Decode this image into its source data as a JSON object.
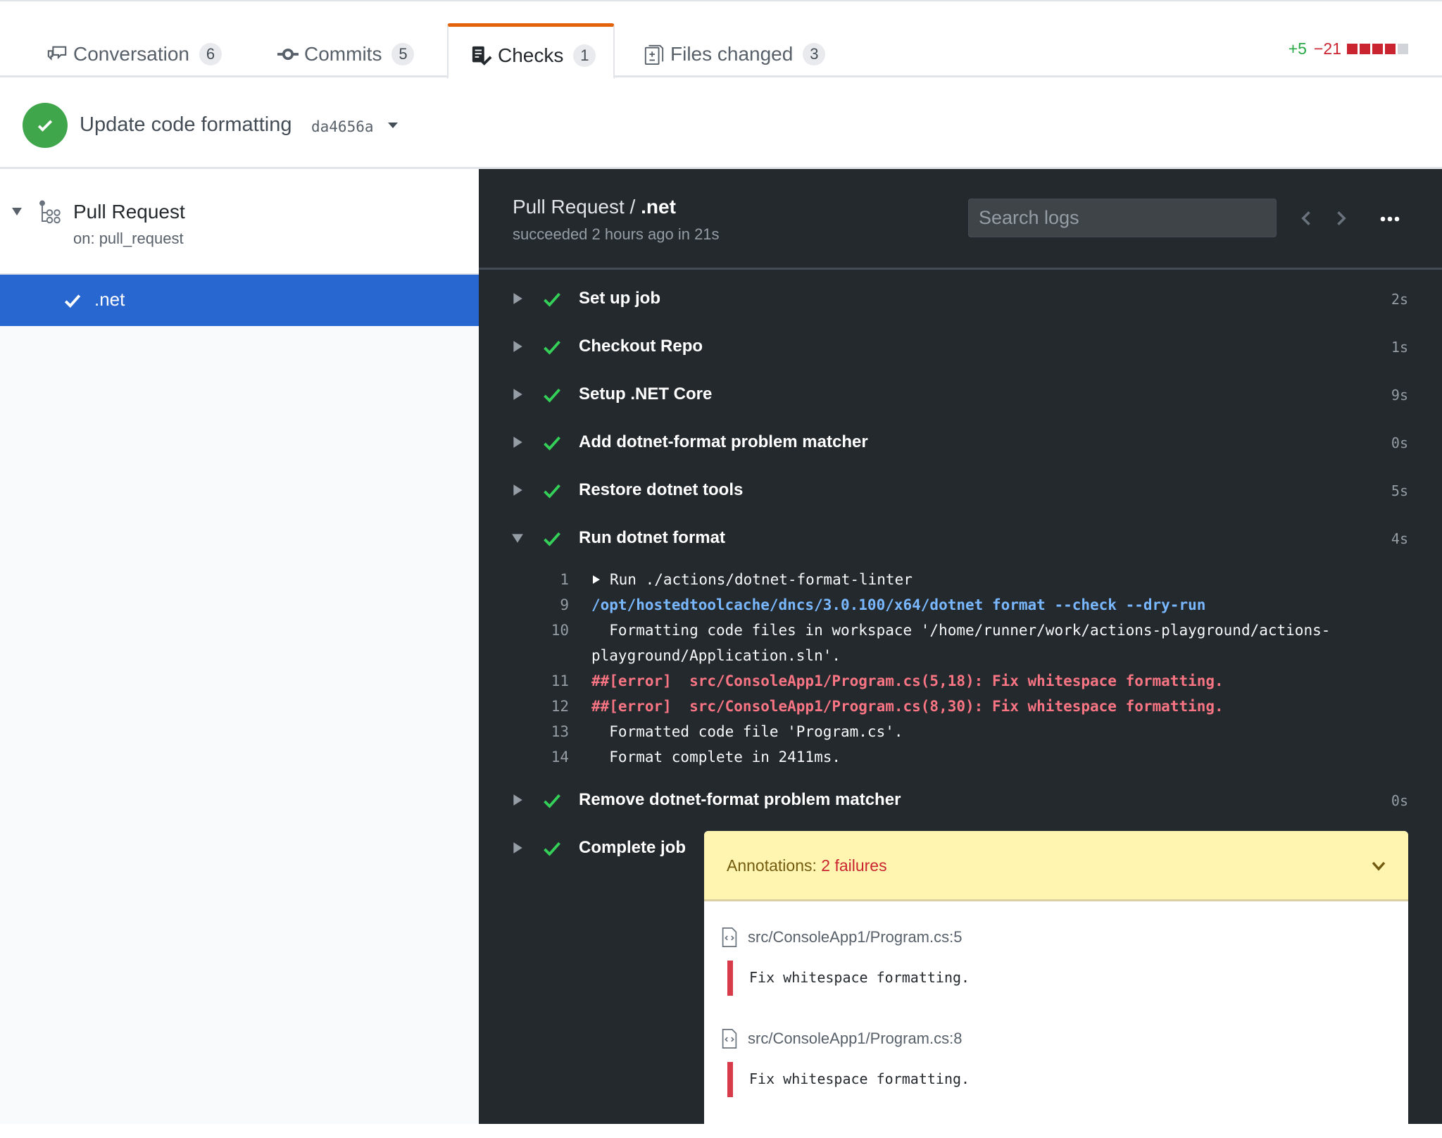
{
  "tabs": [
    {
      "id": "conversation",
      "label": "Conversation",
      "count": "6",
      "icon": "comment-discussion-icon",
      "selected": false
    },
    {
      "id": "commits",
      "label": "Commits",
      "count": "5",
      "icon": "git-commit-icon",
      "selected": false
    },
    {
      "id": "checks",
      "label": "Checks",
      "count": "1",
      "icon": "checklist-icon",
      "selected": true
    },
    {
      "id": "files",
      "label": "Files changed",
      "count": "3",
      "icon": "diff-icon",
      "selected": false
    }
  ],
  "diffstat": {
    "additions": "+5",
    "deletions": "−21",
    "blocks": [
      "deleted",
      "deleted",
      "deleted",
      "deleted",
      "neutral"
    ],
    "colors": {
      "add": "#28a745",
      "del": "#cb2431",
      "neutral": "#d1d5da"
    }
  },
  "commit": {
    "status": "success",
    "title": "Update code formatting",
    "sha": "da4656a"
  },
  "workflow": {
    "name": "Pull Request",
    "trigger": "on: pull_request",
    "jobs": [
      {
        "name": ".net",
        "status": "success",
        "selected": true
      }
    ]
  },
  "log": {
    "title_prefix": "Pull Request / ",
    "title_job": ".net",
    "subtitle": "succeeded 2 hours ago in 21s",
    "search_placeholder": "Search logs",
    "steps": [
      {
        "name": "Set up job",
        "duration": "2s",
        "expanded": false
      },
      {
        "name": "Checkout Repo",
        "duration": "1s",
        "expanded": false
      },
      {
        "name": "Setup .NET Core",
        "duration": "9s",
        "expanded": false
      },
      {
        "name": "Add dotnet-format problem matcher",
        "duration": "0s",
        "expanded": false
      },
      {
        "name": "Restore dotnet tools",
        "duration": "5s",
        "expanded": false
      },
      {
        "name": "Run dotnet format",
        "duration": "4s",
        "expanded": true
      },
      {
        "name": "Remove dotnet-format problem matcher",
        "duration": "0s",
        "expanded": false
      },
      {
        "name": "Complete job",
        "duration": "",
        "expanded": false
      }
    ],
    "lines": [
      {
        "n": "1",
        "text": "Run ./actions/dotnet-format-linter",
        "kind": "group"
      },
      {
        "n": "9",
        "text": "/opt/hostedtoolcache/dncs/3.0.100/x64/dotnet format --check --dry-run",
        "kind": "cmd"
      },
      {
        "n": "10",
        "text": "  Formatting code files in workspace '/home/runner/work/actions-playground/actions-",
        "kind": "normal"
      },
      {
        "n": "",
        "text": "playground/Application.sln'.",
        "kind": "normal"
      },
      {
        "n": "11",
        "text": "##[error]  src/ConsoleApp1/Program.cs(5,18): Fix whitespace formatting.",
        "kind": "err"
      },
      {
        "n": "12",
        "text": "##[error]  src/ConsoleApp1/Program.cs(8,30): Fix whitespace formatting.",
        "kind": "err"
      },
      {
        "n": "13",
        "text": "  Formatted code file 'Program.cs'.",
        "kind": "normal"
      },
      {
        "n": "14",
        "text": "  Format complete in 2411ms.",
        "kind": "normal"
      }
    ]
  },
  "annotations": {
    "label": "Annotations: ",
    "count_label": "2 failures",
    "items": [
      {
        "path": "src/ConsoleApp1/Program.cs:5",
        "message": "Fix whitespace formatting.",
        "level": "failure"
      },
      {
        "path": "src/ConsoleApp1/Program.cs:8",
        "message": "Fix whitespace formatting.",
        "level": "failure"
      }
    ]
  },
  "colors": {
    "accent_tab": "#e36209",
    "success": "#3fa64c",
    "selected_job": "#2866d0",
    "log_bg": "#24292e",
    "annotation_bg": "#fff5b1",
    "failure": "#d73a49"
  }
}
